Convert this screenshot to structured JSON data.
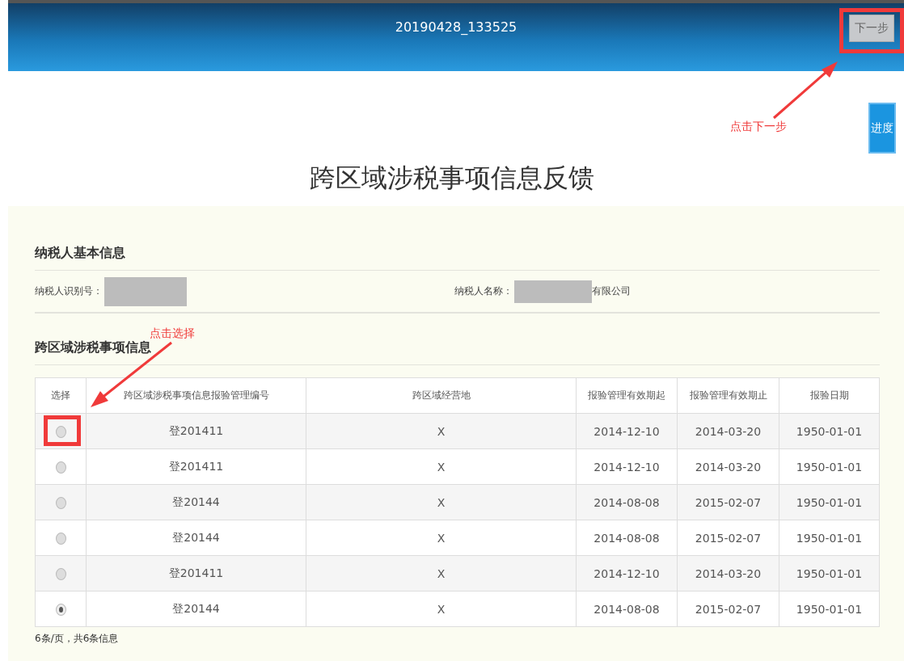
{
  "header": {
    "title": "20190428_133525",
    "next_button": "下一步"
  },
  "progress_button": "进度",
  "page_title": "跨区域涉税事项信息反馈",
  "taxpayer_section": {
    "heading": "纳税人基本信息",
    "fields": [
      {
        "label": "纳税人识别号："
      },
      {
        "label": "纳税人名称：",
        "value": "有限公司"
      }
    ]
  },
  "matters_section": {
    "heading": "跨区域涉税事项信息",
    "table": {
      "select_column": "选择",
      "columns": [
        "跨区域涉税事项信息报验管理编号",
        "跨区域经营地",
        "报验管理有效期起",
        "报验管理有效期止",
        "报验日期"
      ],
      "rows": [
        {
          "selected": false,
          "cells": [
            "登201411",
            "X",
            "2014-12-10",
            "2014-03-20",
            "1950-01-01"
          ]
        },
        {
          "selected": false,
          "cells": [
            "登201411",
            "X",
            "2014-12-10",
            "2014-03-20",
            "1950-01-01"
          ]
        },
        {
          "selected": false,
          "cells": [
            "登20144",
            "X",
            "2014-08-08",
            "2015-02-07",
            "1950-01-01"
          ]
        },
        {
          "selected": false,
          "cells": [
            "登20144",
            "X",
            "2014-08-08",
            "2015-02-07",
            "1950-01-01"
          ]
        },
        {
          "selected": false,
          "cells": [
            "登201411",
            "X",
            "2014-12-10",
            "2014-03-20",
            "1950-01-01"
          ]
        },
        {
          "selected": true,
          "cells": [
            "登20144",
            "X",
            "2014-08-08",
            "2015-02-07",
            "1950-01-01"
          ]
        }
      ]
    },
    "pagination": "6条/页，共6条信息"
  },
  "annotations": [
    {
      "kind": "next",
      "text": "点击下一步"
    },
    {
      "kind": "select",
      "text": "点击选择"
    }
  ]
}
